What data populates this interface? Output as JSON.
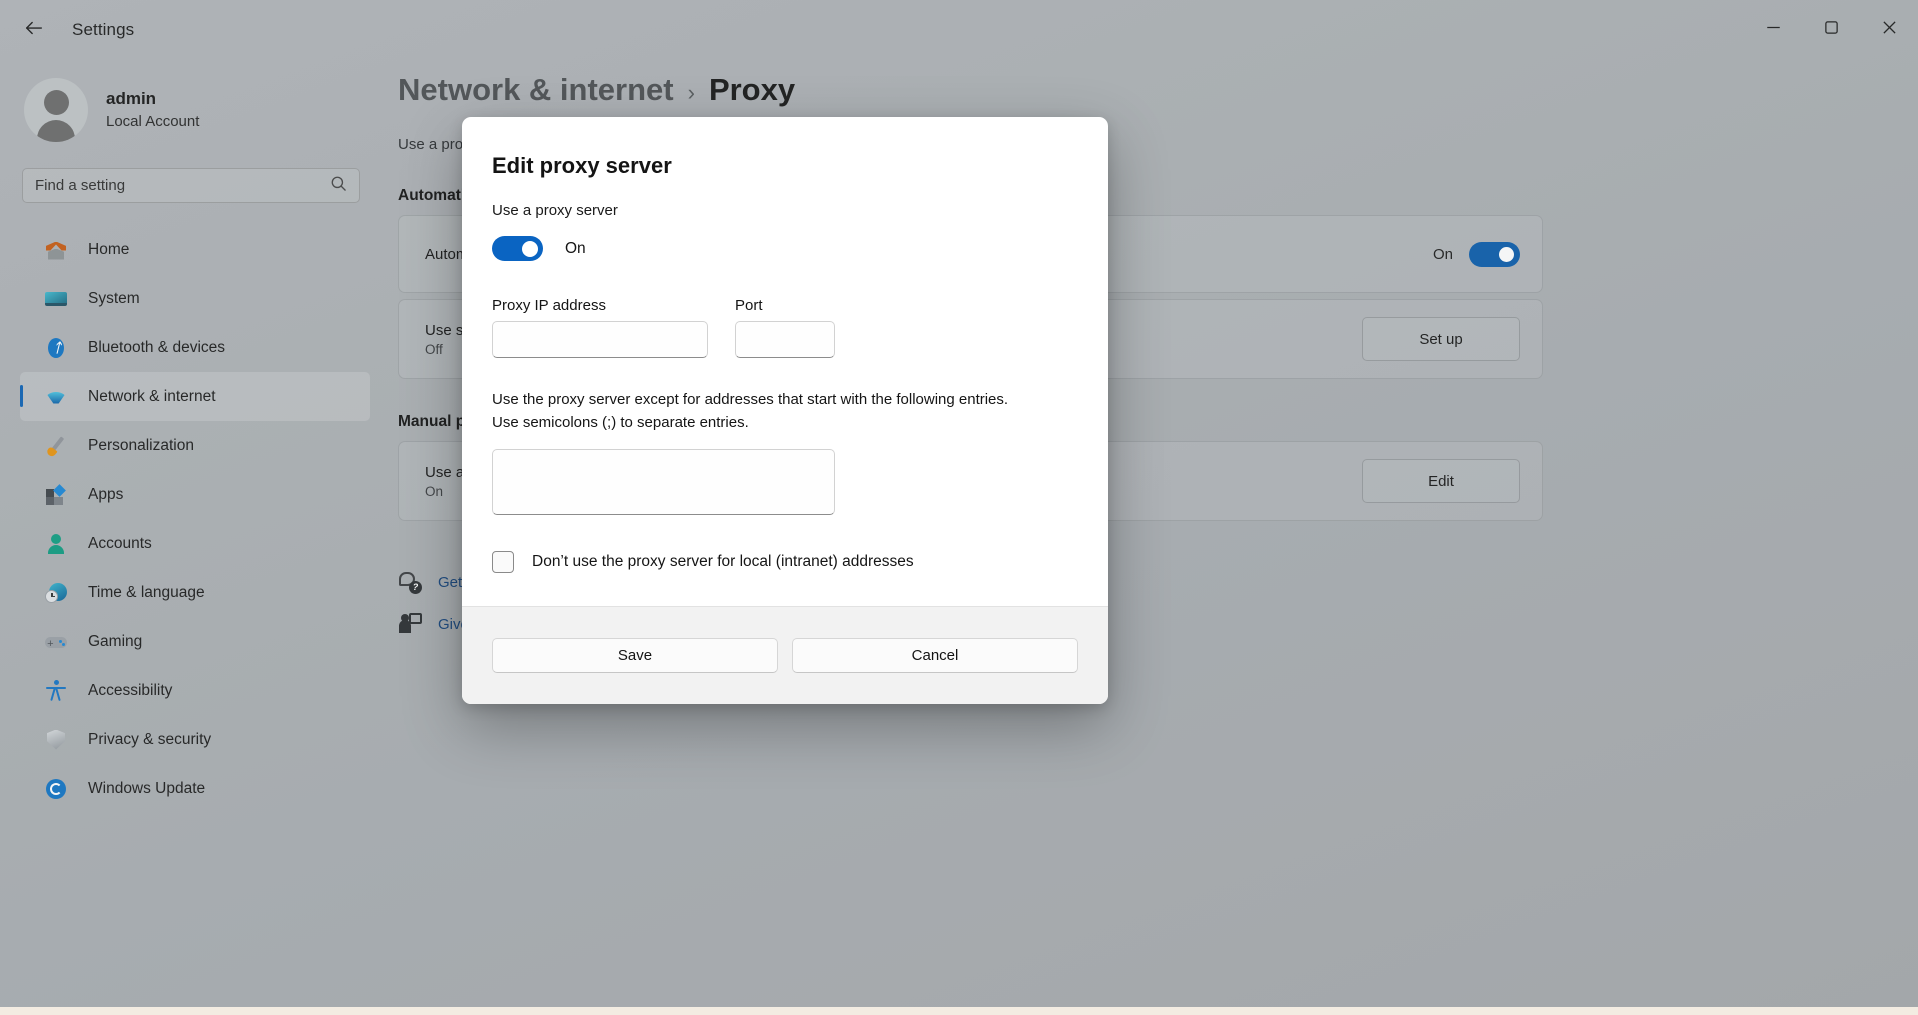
{
  "window": {
    "app_title": "Settings",
    "back_icon": "back-arrow-icon",
    "minimize_label": "Minimize",
    "maximize_label": "Maximize",
    "close_label": "Close"
  },
  "sidebar": {
    "profile": {
      "name": "admin",
      "account_type": "Local Account",
      "avatar_icon": "person-avatar-icon"
    },
    "search": {
      "placeholder": "Find a setting",
      "icon": "search-icon"
    },
    "items": [
      {
        "label": "Home",
        "icon": "home-icon",
        "selected": false
      },
      {
        "label": "System",
        "icon": "monitor-icon",
        "selected": false
      },
      {
        "label": "Bluetooth & devices",
        "icon": "bluetooth-icon",
        "selected": false
      },
      {
        "label": "Network & internet",
        "icon": "wifi-icon",
        "selected": true
      },
      {
        "label": "Personalization",
        "icon": "paintbrush-icon",
        "selected": false
      },
      {
        "label": "Apps",
        "icon": "apps-icon",
        "selected": false
      },
      {
        "label": "Accounts",
        "icon": "account-icon",
        "selected": false
      },
      {
        "label": "Time & language",
        "icon": "clock-globe-icon",
        "selected": false
      },
      {
        "label": "Gaming",
        "icon": "gamepad-icon",
        "selected": false
      },
      {
        "label": "Accessibility",
        "icon": "accessibility-icon",
        "selected": false
      },
      {
        "label": "Privacy & security",
        "icon": "shield-icon",
        "selected": false
      },
      {
        "label": "Windows Update",
        "icon": "update-sync-icon",
        "selected": false
      }
    ]
  },
  "page": {
    "breadcrumb_parent": "Network & internet",
    "breadcrumb_separator": "›",
    "breadcrumb_current": "Proxy",
    "description": "Use a proxy server for Wi-Fi and Ethernet connections.",
    "sections": [
      {
        "title": "Automatic proxy setup",
        "rows": [
          {
            "title": "Automatically detect settings",
            "subtitle": "",
            "state_label": "On",
            "control": "toggle",
            "toggle_on": true
          },
          {
            "title": "Use setup script",
            "subtitle": "Off",
            "button_label": "Set up",
            "control": "button"
          }
        ]
      },
      {
        "title": "Manual proxy setup",
        "rows": [
          {
            "title": "Use a proxy server",
            "subtitle": "On",
            "button_label": "Edit",
            "control": "button"
          }
        ]
      }
    ],
    "links": [
      {
        "label": "Get help",
        "icon": "help-icon"
      },
      {
        "label": "Give feedback",
        "icon": "feedback-icon"
      }
    ]
  },
  "dialog": {
    "title": "Edit proxy server",
    "use_proxy_label": "Use a proxy server",
    "toggle_state": "On",
    "toggle_on": true,
    "ip_label": "Proxy IP address",
    "ip_value": "",
    "ip_placeholder": "",
    "port_label": "Port",
    "port_value": "",
    "port_placeholder": "",
    "helper_line1": "Use the proxy server except for addresses that start with the following entries.",
    "helper_line2": "Use semicolons (;) to separate entries.",
    "exceptions_value": "",
    "exceptions_placeholder": "",
    "checkbox_label": "Don’t use the proxy server for local (intranet) addresses",
    "checkbox_checked": false,
    "save_label": "Save",
    "cancel_label": "Cancel"
  },
  "colors": {
    "accent": "#0b5cab",
    "dialog_accent": "#0a64c2",
    "link": "#14457e",
    "selected_bar": "#0d61b5"
  }
}
